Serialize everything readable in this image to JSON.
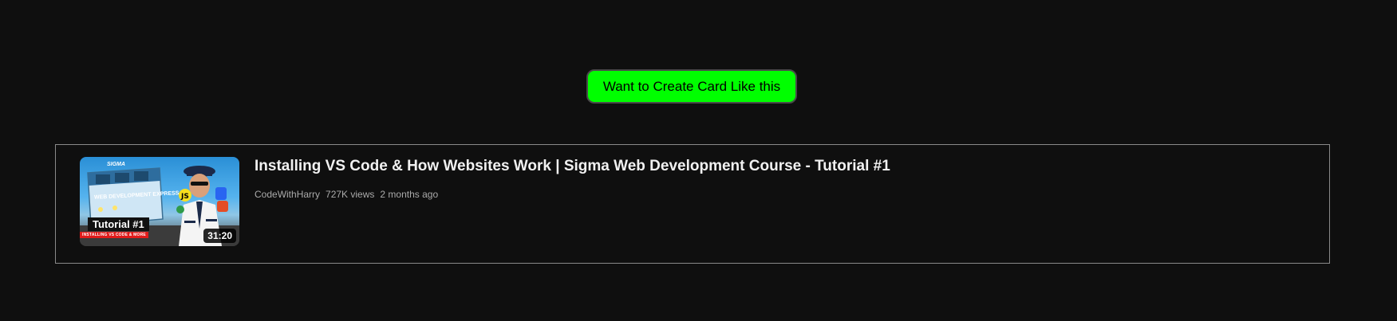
{
  "cta": {
    "label": "Want to Create Card Like this"
  },
  "video": {
    "title": "Installing VS Code & How Websites Work | Sigma Web Development Course - Tutorial #1",
    "channel": "CodeWithHarry",
    "views": "727K views",
    "age": "2 months ago",
    "duration": "31:20",
    "thumbnail": {
      "brand_text": "SIGMA",
      "banner_text": "WEB DEVELOPMENT EXPRESS",
      "series_label": "Tutorial #1",
      "sub_label": "INSTALLING VS CODE & MORE"
    }
  },
  "colors": {
    "background": "#0f0f0f",
    "cta_bg": "#00ff00",
    "card_border": "#8a8a8a",
    "title": "#f1f1f1",
    "meta": "#aaaaaa"
  }
}
